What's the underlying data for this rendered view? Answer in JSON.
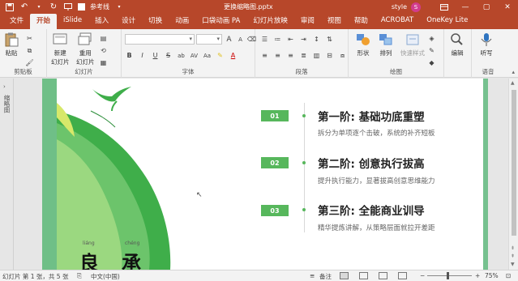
{
  "titlebar": {
    "autosave_label": "参考线",
    "document_title": "更换缩略图.pptx",
    "user_name": "style",
    "user_initial": "S",
    "minimize": "—",
    "restore": "▢",
    "close": "✕"
  },
  "menu": {
    "tabs": [
      "文件",
      "开始",
      "iSlide",
      "插入",
      "设计",
      "切换",
      "动画",
      "口袋动画 PA",
      "幻灯片放映",
      "审阅",
      "视图",
      "帮助",
      "ACROBAT",
      "OneKey Lite"
    ],
    "active": "开始"
  },
  "ribbon": {
    "clipboard": {
      "paste": "粘贴",
      "group": "剪贴板"
    },
    "slides": {
      "new_slide": "新建\n幻灯片",
      "reuse": "重用\n幻灯片",
      "group": "幻灯片"
    },
    "font": {
      "size_up": "A",
      "size_down": "A",
      "bold": "B",
      "italic": "I",
      "underline": "U",
      "strike": "S",
      "shadow": "ab",
      "spacing": "AV",
      "case": "Aa",
      "color": "A",
      "group": "字体"
    },
    "paragraph": {
      "group": "段落"
    },
    "drawing": {
      "shapes": "形状",
      "arrange": "排列",
      "quick_styles": "快速样式",
      "group": "绘图"
    },
    "editing": {
      "label": "编辑"
    },
    "voice": {
      "dictate": "听写",
      "group": "语音"
    }
  },
  "left_pane": {
    "label": "缩略图"
  },
  "slide": {
    "sections": [
      {
        "num": "01",
        "title": "第一阶: 基础功底重塑",
        "desc": "拆分为单项逐个击破，系统的补齐短板"
      },
      {
        "num": "02",
        "title": "第二阶: 创意执行拔高",
        "desc": "提升执行能力，显著拔高创意思维能力"
      },
      {
        "num": "03",
        "title": "第三阶: 全能商业训导",
        "desc": "精华提炼讲解，从策略层面就拉开差距"
      }
    ],
    "pinyin": [
      "liáng",
      "chéng"
    ],
    "chars": [
      "良",
      "承"
    ]
  },
  "statusbar": {
    "slide_info": "幻灯片 第 1 张，共 5 张",
    "language": "中文(中国)",
    "notes": "备注",
    "zoom": "75%"
  },
  "colors": {
    "brand": "#b7472a",
    "accent_green": "#57b75c"
  }
}
